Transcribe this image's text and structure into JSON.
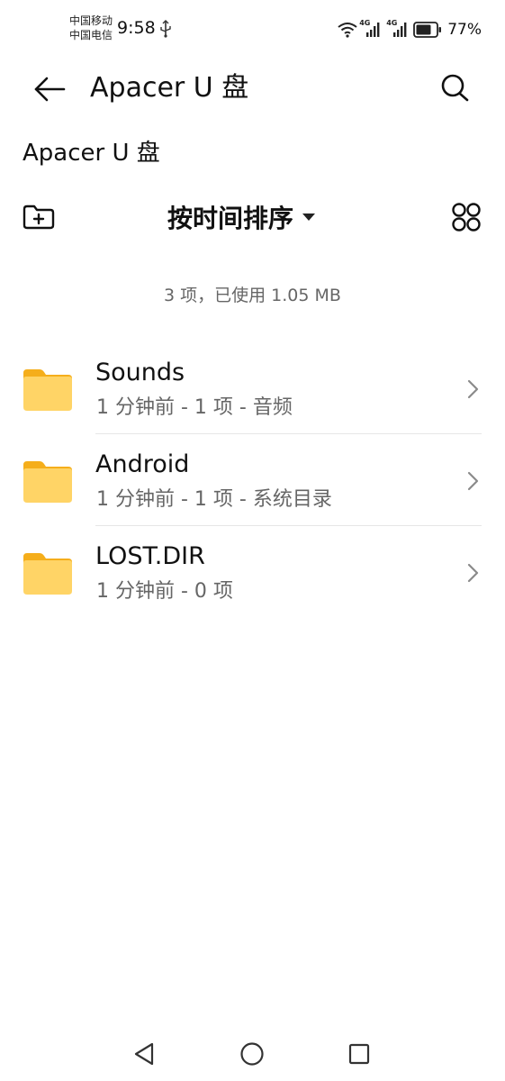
{
  "status_bar": {
    "carrier_1": "中国移动",
    "carrier_2": "中国电信",
    "time": "9:58",
    "network_1": "4G",
    "network_2": "4G",
    "battery_percent": "77%",
    "icons": [
      "usb-icon",
      "wifi-icon",
      "signal-icon",
      "signal-icon",
      "battery-icon"
    ]
  },
  "header": {
    "title": "Apacer U 盘"
  },
  "breadcrumb": {
    "path": "Apacer U 盘"
  },
  "toolbar": {
    "sort_label": "按时间排序"
  },
  "summary": {
    "text": "3 项，已使用 1.05 MB"
  },
  "files": [
    {
      "name": "Sounds",
      "meta": "1 分钟前 - 1 项 - 音频"
    },
    {
      "name": "Android",
      "meta": "1 分钟前 - 1 项 - 系统目录"
    },
    {
      "name": "LOST.DIR",
      "meta": "1 分钟前 - 0 项"
    }
  ],
  "colors": {
    "folder": "#FFD466",
    "folder_tab": "#F5AE1B",
    "text_primary": "#111111",
    "text_secondary": "#666666"
  }
}
